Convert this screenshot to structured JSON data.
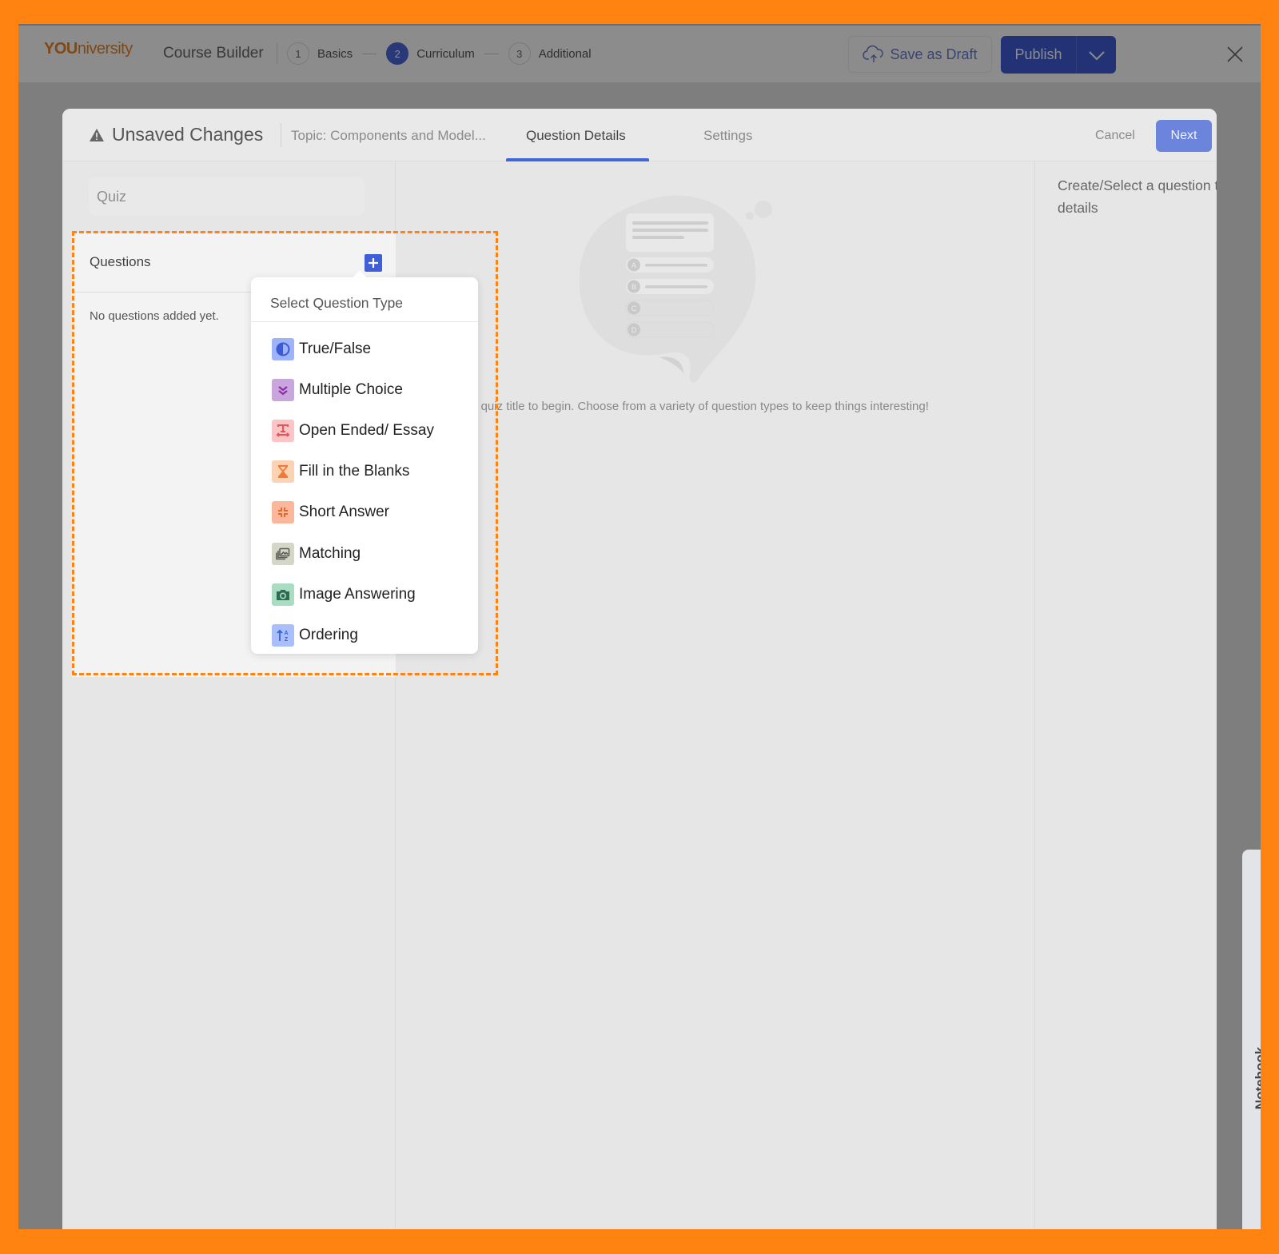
{
  "app": {
    "logo": {
      "brand_you": "YOU",
      "brand_rest": "niversity"
    },
    "title": "Course Builder",
    "steps": [
      {
        "num": "1",
        "label": "Basics",
        "active": false
      },
      {
        "num": "2",
        "label": "Curriculum",
        "active": true
      },
      {
        "num": "3",
        "label": "Additional",
        "active": false
      }
    ],
    "save_draft_label": "Save as Draft",
    "publish_label": "Publish"
  },
  "modal": {
    "status_label": "Unsaved Changes",
    "topic": "Topic: Components and Model...",
    "tabs": [
      {
        "label": "Question Details",
        "active": true
      },
      {
        "label": "Settings",
        "active": false
      }
    ],
    "cancel_label": "Cancel",
    "next_label": "Next",
    "quiz_input": {
      "value": "",
      "placeholder": "Quiz"
    },
    "questions": {
      "title": "Questions",
      "empty_text": "No questions added yet."
    },
    "center_empty_text": "Enter a quiz title to begin. Choose from a variety of question types to keep things interesting!",
    "right_empty_text": "Create/Select a question to view details"
  },
  "question_type_menu": {
    "title": "Select Question Type",
    "items": [
      {
        "label": "True/False",
        "icon": "half-circle-icon",
        "bg": "#9fb3f8",
        "fg": "#3a5ad6"
      },
      {
        "label": "Multiple Choice",
        "icon": "double-check-icon",
        "bg": "#c9a6dc",
        "fg": "#8a2ea8"
      },
      {
        "label": "Open Ended/ Essay",
        "icon": "text-width-icon",
        "bg": "#fbc5c5",
        "fg": "#e5545a"
      },
      {
        "label": "Fill in the Blanks",
        "icon": "hourglass-icon",
        "bg": "#fbd2b4",
        "fg": "#f07a36"
      },
      {
        "label": "Short Answer",
        "icon": "compress-icon",
        "bg": "#fbb79c",
        "fg": "#e8662c"
      },
      {
        "label": "Matching",
        "icon": "image-stack-icon",
        "bg": "#d4d6c8",
        "fg": "#5c5f58"
      },
      {
        "label": "Image Answering",
        "icon": "camera-icon",
        "bg": "#a9dcc0",
        "fg": "#2f6b52"
      },
      {
        "label": "Ordering",
        "icon": "sort-az-icon",
        "bg": "#a8bff9",
        "fg": "#3760d8"
      }
    ]
  },
  "notebook": {
    "label": "Notebook"
  },
  "colors": {
    "frame": "#ff8310",
    "accent": "#3f5fd8"
  }
}
